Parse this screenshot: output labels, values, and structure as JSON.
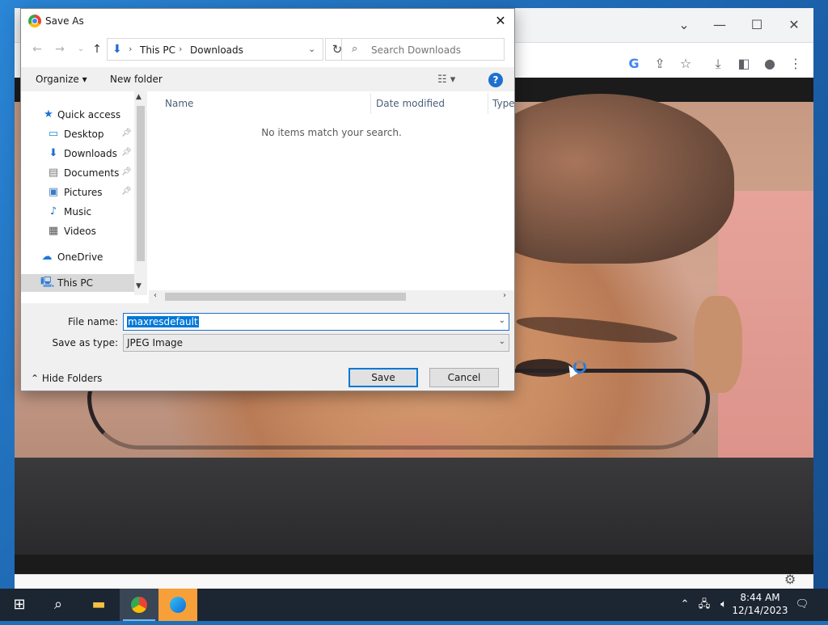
{
  "dialog": {
    "title": "Save As",
    "nav": {
      "path": [
        "This PC",
        "Downloads"
      ],
      "search_placeholder": "Search Downloads"
    },
    "commands": {
      "organize": "Organize ▾",
      "new_folder": "New folder"
    },
    "sidebar": {
      "items": [
        {
          "label": "Quick access",
          "icon": "star-icon"
        },
        {
          "label": "Desktop",
          "icon": "desktop-icon"
        },
        {
          "label": "Downloads",
          "icon": "download-icon"
        },
        {
          "label": "Documents",
          "icon": "documents-icon"
        },
        {
          "label": "Pictures",
          "icon": "pictures-icon"
        },
        {
          "label": "Music",
          "icon": "music-icon"
        },
        {
          "label": "Videos",
          "icon": "videos-icon"
        },
        {
          "label": "OneDrive",
          "icon": "cloud-icon"
        },
        {
          "label": "This PC",
          "icon": "computer-icon"
        }
      ]
    },
    "columns": [
      "Name",
      "Date modified",
      "Type"
    ],
    "empty_message": "No items match your search.",
    "file_name_label": "File name:",
    "file_name_value": "maxresdefault",
    "save_as_type_label": "Save as type:",
    "save_as_type_value": "JPEG Image",
    "hide_folders": "Hide Folders",
    "save_button": "Save",
    "cancel_button": "Cancel"
  },
  "taskbar": {
    "time": "8:44 AM",
    "date": "12/14/2023"
  },
  "colors": {
    "accent": "#0078d7",
    "taskbar": "#1c2532",
    "edge_highlight": "#f7a03a"
  }
}
